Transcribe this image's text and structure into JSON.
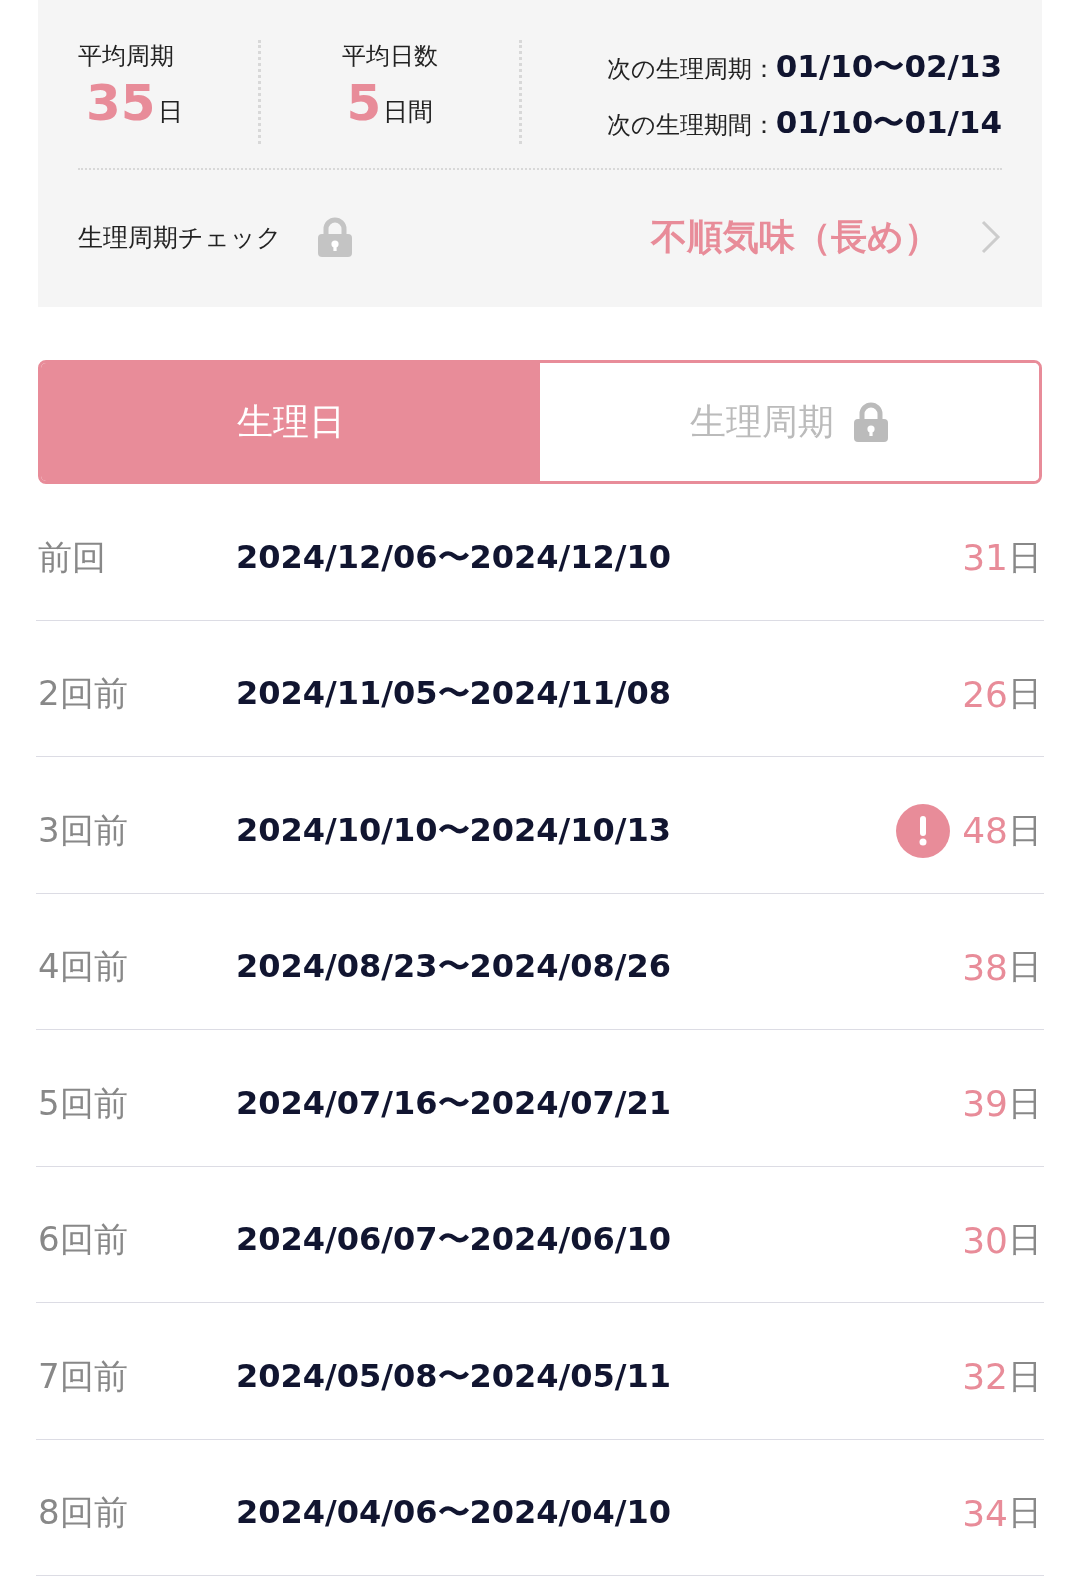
{
  "summary": {
    "stats": [
      {
        "label": "平均周期",
        "value": "35",
        "unit": "日"
      },
      {
        "label": "平均日数",
        "value": "5",
        "unit": "日間"
      }
    ],
    "next": [
      {
        "label": "次の生理周期：",
        "value": "01/10〜02/13"
      },
      {
        "label": "次の生理期間：",
        "value": "01/10〜01/14"
      }
    ],
    "check": {
      "label": "生理周期チェック",
      "locked": true,
      "result": "不順気味（長め）"
    }
  },
  "tabs": [
    {
      "label": "生理日",
      "selected": true,
      "locked": false
    },
    {
      "label": "生理周期",
      "selected": false,
      "locked": true
    }
  ],
  "rows": [
    {
      "label": "前回",
      "range": "2024/12/06〜2024/12/10",
      "days": "31",
      "unit": "日",
      "alert": false
    },
    {
      "label": "2回前",
      "range": "2024/11/05〜2024/11/08",
      "days": "26",
      "unit": "日",
      "alert": false
    },
    {
      "label": "3回前",
      "range": "2024/10/10〜2024/10/13",
      "days": "48",
      "unit": "日",
      "alert": true
    },
    {
      "label": "4回前",
      "range": "2024/08/23〜2024/08/26",
      "days": "38",
      "unit": "日",
      "alert": false
    },
    {
      "label": "5回前",
      "range": "2024/07/16〜2024/07/21",
      "days": "39",
      "unit": "日",
      "alert": false
    },
    {
      "label": "6回前",
      "range": "2024/06/07〜2024/06/10",
      "days": "30",
      "unit": "日",
      "alert": false
    },
    {
      "label": "7回前",
      "range": "2024/05/08〜2024/05/11",
      "days": "32",
      "unit": "日",
      "alert": false
    },
    {
      "label": "8回前",
      "range": "2024/04/06〜2024/04/10",
      "days": "34",
      "unit": "日",
      "alert": false
    }
  ]
}
